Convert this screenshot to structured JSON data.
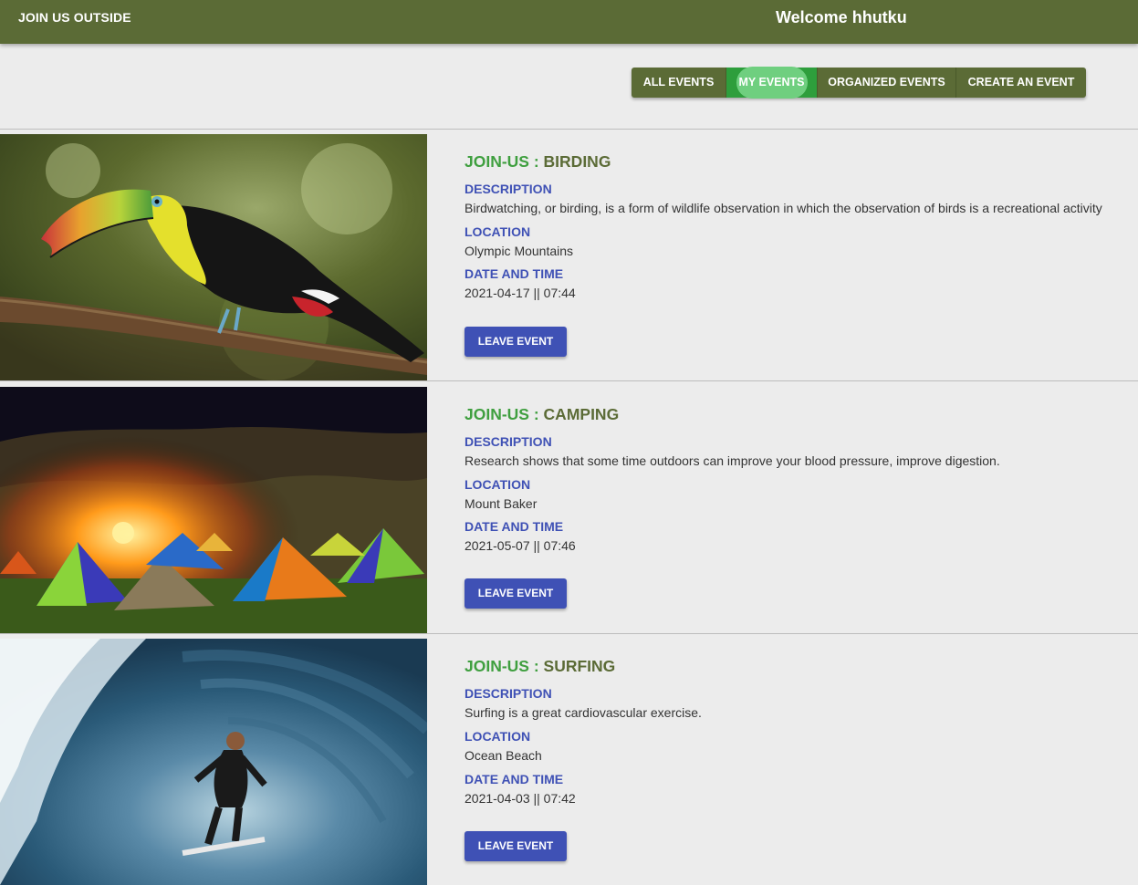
{
  "header": {
    "brand": "JOIN US OUTSIDE",
    "welcome": "Welcome hhutku"
  },
  "tabs": [
    {
      "label": "ALL EVENTS"
    },
    {
      "label": "MY EVENTS",
      "active": true
    },
    {
      "label": "ORGANIZED EVENTS"
    },
    {
      "label": "CREATE AN EVENT"
    }
  ],
  "labels": {
    "description": "DESCRIPTION",
    "location": "LOCATION",
    "date_time": "DATE AND TIME",
    "title_prefix": "JOIN-US : "
  },
  "events": [
    {
      "name": "BIRDING",
      "description": "Birdwatching, or birding, is a form of wildlife observation in which the observation of birds is a recreational activity",
      "location": "Olympic Mountains",
      "date_time": "2021-04-17 || 07:44",
      "button": "LEAVE EVENT",
      "image": "toucan-photo"
    },
    {
      "name": "CAMPING",
      "description": "Research shows that some time outdoors can improve your blood pressure, improve digestion.",
      "location": "Mount Baker",
      "date_time": "2021-05-07 || 07:46",
      "button": "LEAVE EVENT",
      "image": "campsite-tents-photo"
    },
    {
      "name": "SURFING",
      "description": "Surfing is a great cardiovascular exercise.",
      "location": "Ocean Beach",
      "date_time": "2021-04-03 || 07:42",
      "button": "LEAVE EVENT",
      "image": "surfer-wave-photo"
    }
  ],
  "colors": {
    "header_bg": "#5b6b36",
    "active_tab": "#2e9e3c",
    "label_blue": "#3f51b5",
    "title_green": "#3f9f3f"
  }
}
